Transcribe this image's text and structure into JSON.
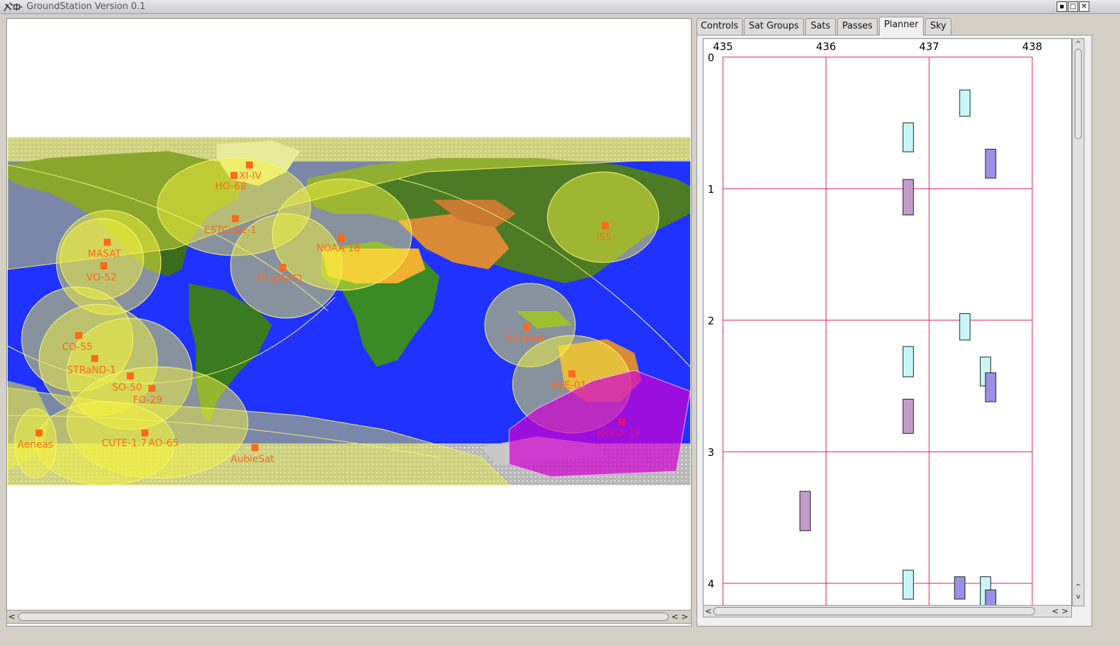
{
  "window": {
    "title": "GroundStation Version 0.1",
    "app_icon": "groundstation-app-icon",
    "controls": [
      "restore",
      "maximize",
      "close"
    ],
    "control_glyphs": [
      "▪",
      "□",
      "✕"
    ]
  },
  "tabs": [
    {
      "label": "Controls",
      "active": false
    },
    {
      "label": "Sat Groups",
      "active": false
    },
    {
      "label": "Sats",
      "active": false
    },
    {
      "label": "Passes",
      "active": false
    },
    {
      "label": "Planner",
      "active": true
    },
    {
      "label": "Sky",
      "active": false
    }
  ],
  "map": {
    "satellites": [
      {
        "name": "HO-68"
      },
      {
        "name": "XI-IV"
      },
      {
        "name": "ESTCube-1"
      },
      {
        "name": "MASAT"
      },
      {
        "name": "VO-52"
      },
      {
        "name": "NOAA 18"
      },
      {
        "name": "ITUpSAT1"
      },
      {
        "name": "ISS"
      },
      {
        "name": "CO-55"
      },
      {
        "name": "STRaND-1"
      },
      {
        "name": "SO-50"
      },
      {
        "name": "FO-29"
      },
      {
        "name": "MCubed"
      },
      {
        "name": "NEE-01"
      },
      {
        "name": "NOAA 19"
      },
      {
        "name": "Aeneas"
      },
      {
        "name": "CUTE-1.7"
      },
      {
        "name": "AO-65"
      },
      {
        "name": "AubieSat"
      }
    ],
    "label_color": "#ff6a1a",
    "selected_color": "#e0107a",
    "footprint_color": "#f0f040"
  },
  "planner": {
    "x_ticks": [
      "435",
      "436",
      "437",
      "438"
    ],
    "y_ticks": [
      "0",
      "1",
      "2",
      "3",
      "4"
    ],
    "grid_color": "#d81b60",
    "colors": {
      "cyan": "#c8f6f8",
      "purple": "#9a90e6",
      "mauve": "#c49ccb"
    },
    "passes": [
      {
        "freq": 436.8,
        "t0": 0.5,
        "t1": 0.72,
        "color": "cyan"
      },
      {
        "freq": 436.8,
        "t0": 0.93,
        "t1": 1.2,
        "color": "mauve"
      },
      {
        "freq": 437.35,
        "t0": 0.25,
        "t1": 0.45,
        "color": "cyan"
      },
      {
        "freq": 437.6,
        "t0": 0.7,
        "t1": 0.92,
        "color": "purple"
      },
      {
        "freq": 437.35,
        "t0": 1.95,
        "t1": 2.15,
        "color": "cyan"
      },
      {
        "freq": 436.8,
        "t0": 2.2,
        "t1": 2.43,
        "color": "cyan"
      },
      {
        "freq": 437.55,
        "t0": 2.28,
        "t1": 2.5,
        "color": "cyan"
      },
      {
        "freq": 437.6,
        "t0": 2.4,
        "t1": 2.62,
        "color": "purple"
      },
      {
        "freq": 436.8,
        "t0": 2.6,
        "t1": 2.86,
        "color": "mauve"
      },
      {
        "freq": 435.8,
        "t0": 3.3,
        "t1": 3.6,
        "color": "mauve"
      },
      {
        "freq": 436.8,
        "t0": 3.9,
        "t1": 4.12,
        "color": "cyan"
      },
      {
        "freq": 437.3,
        "t0": 3.95,
        "t1": 4.12,
        "color": "purple"
      },
      {
        "freq": 437.55,
        "t0": 3.95,
        "t1": 4.2,
        "color": "cyan"
      },
      {
        "freq": 437.6,
        "t0": 4.05,
        "t1": 4.2,
        "color": "purple"
      }
    ]
  },
  "scroll": {
    "left_arrow": "<",
    "right_arrow": ">",
    "up_arrow": "^",
    "down_arrow": "v"
  }
}
